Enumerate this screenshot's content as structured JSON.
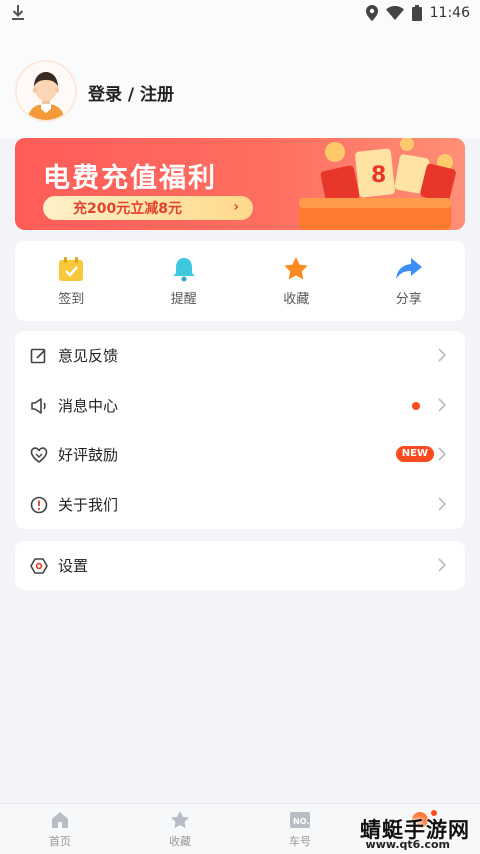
{
  "status_bar": {
    "time": "11:46"
  },
  "user": {
    "login_label": "登录 / 注册"
  },
  "banner": {
    "title": "电费充值福利",
    "pill_text": "充200元立减8元",
    "arrow": "›"
  },
  "quick_actions": [
    {
      "label": "签到",
      "icon": "calendar-check-icon"
    },
    {
      "label": "提醒",
      "icon": "bell-icon"
    },
    {
      "label": "收藏",
      "icon": "star-icon"
    },
    {
      "label": "分享",
      "icon": "share-arrow-icon"
    }
  ],
  "menu": [
    {
      "label": "意见反馈",
      "icon": "edit-icon"
    },
    {
      "label": "消息中心",
      "icon": "speaker-icon"
    },
    {
      "label": "好评鼓励",
      "icon": "heart-icon",
      "badge": "NEW"
    },
    {
      "label": "关于我们",
      "icon": "info-icon"
    }
  ],
  "settings": {
    "label": "设置",
    "icon": "hexagon-settings-icon"
  },
  "tabs": [
    {
      "label": "首页",
      "icon": "home-icon"
    },
    {
      "label": "收藏",
      "icon": "star-icon"
    },
    {
      "label": "车号",
      "icon": "plate-icon",
      "icon_text": "NO."
    }
  ],
  "watermark": {
    "text": "蜻蜓手游网",
    "url": "www.qt6.com"
  },
  "colors": {
    "accent": "#ff4a1f",
    "banner": "#ff5c58",
    "background": "#f3f4f8"
  }
}
